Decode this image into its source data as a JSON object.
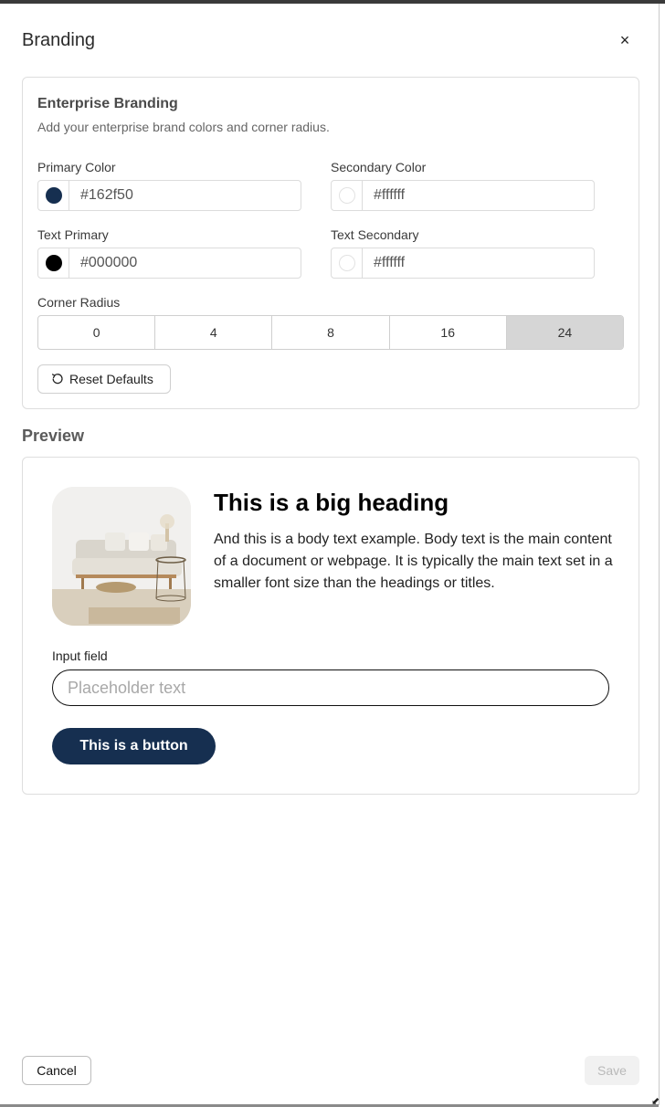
{
  "modal": {
    "title": "Branding",
    "close_label": "×"
  },
  "branding": {
    "title": "Enterprise Branding",
    "description": "Add your enterprise brand colors and corner radius.",
    "primary_color": {
      "label": "Primary Color",
      "value": "#162f50",
      "swatch": "#162f50"
    },
    "secondary_color": {
      "label": "Secondary Color",
      "value": "#ffffff",
      "swatch": "#ffffff"
    },
    "text_primary": {
      "label": "Text Primary",
      "value": "#000000",
      "swatch": "#000000"
    },
    "text_secondary": {
      "label": "Text Secondary",
      "value": "#ffffff",
      "swatch": "#ffffff"
    },
    "corner_radius": {
      "label": "Corner Radius",
      "options": [
        "0",
        "4",
        "8",
        "16",
        "24"
      ],
      "selected": "24"
    },
    "reset_label": "Reset Defaults",
    "reset_icon": "reset-icon"
  },
  "preview": {
    "title": "Preview",
    "image_icon": "sofa-room-image",
    "heading": "This is a big heading",
    "body": "And this is a body text example. Body text is the main content of a document or webpage. It is typically the main text set in a smaller font size than the headings or titles.",
    "input_label": "Input field",
    "input_placeholder": "Placeholder text",
    "button_label": "This is a button",
    "button_color": "#162f50"
  },
  "footer": {
    "cancel_label": "Cancel",
    "save_label": "Save"
  }
}
